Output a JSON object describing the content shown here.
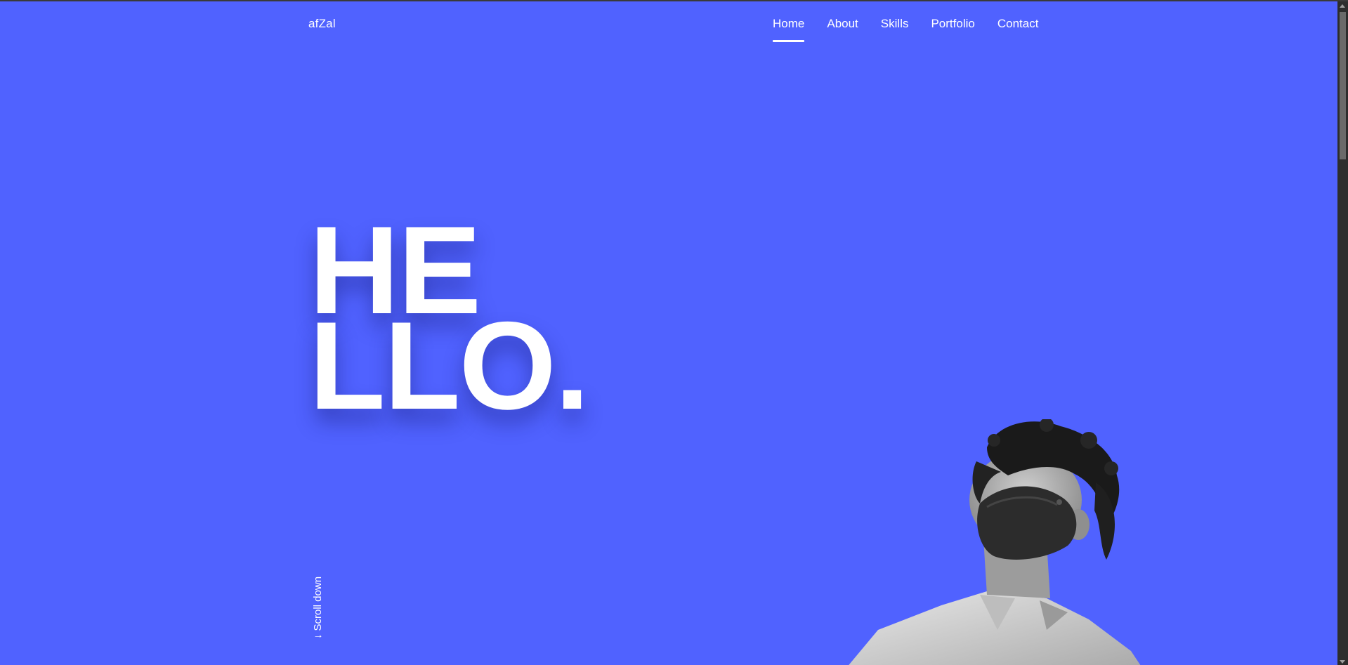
{
  "brand": {
    "name": "afZal"
  },
  "nav": {
    "items": [
      {
        "label": "Home",
        "active": true
      },
      {
        "label": "About",
        "active": false
      },
      {
        "label": "Skills",
        "active": false
      },
      {
        "label": "Portfolio",
        "active": false
      },
      {
        "label": "Contact",
        "active": false
      }
    ]
  },
  "hero": {
    "line1": "HE",
    "line2": "LLO."
  },
  "scroll_hint": {
    "arrow": "↓",
    "label": "Scroll down"
  },
  "colors": {
    "background": "#5062ff",
    "text": "#ffffff"
  },
  "icons": {
    "scroll_arrow": "arrow-down-icon"
  }
}
